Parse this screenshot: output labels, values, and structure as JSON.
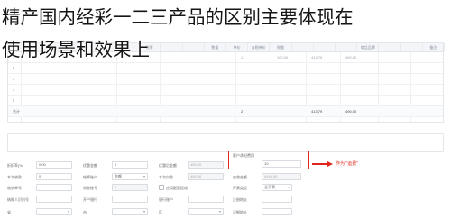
{
  "caption": {
    "line1": "精产国内经彩一二三产品的区别主要体现在",
    "line2": "使用场景和效果上"
  },
  "grid": {
    "columns": [
      "",
      "",
      "",
      "",
      "",
      "",
      "税率",
      "",
      "",
      "数量",
      "单价",
      "含税单价",
      "税额",
      "",
      "",
      "",
      "商品品牌",
      "",
      "",
      "备注"
    ],
    "row_numbers": [
      "1",
      "2",
      "3",
      "4",
      "5"
    ],
    "row_values": {
      "qty": "1",
      "price": "100.00",
      "amount": "413.75",
      "total": "490.00"
    },
    "total_row": {
      "label": "合计",
      "qty": "2",
      "amount": "413.79",
      "total": "490.00"
    }
  },
  "form": {
    "fields": [
      {
        "label": "折扣率(%)",
        "value": "0.00"
      },
      {
        "label": "优惠金额",
        "value": "0"
      },
      {
        "label": "优惠后金额",
        "value": "490.00"
      },
      {
        "label": "客户承担费用",
        "value": "10"
      },
      {
        "label": "本次收款",
        "value": "0"
      },
      {
        "label": "结算账户",
        "value": "金额"
      },
      {
        "label": "本次欠款",
        "value": "490.00"
      },
      {
        "label": "应收金额",
        "value": "4918.00"
      },
      {
        "label": "物流单号",
        "value": ""
      },
      {
        "label": "销售账号",
        "value": "0"
      },
      {
        "label": "应用配置提成",
        "value": ""
      },
      {
        "label": "开票类型",
        "value": "全开票"
      },
      {
        "label": "纳税人识别号",
        "value": ""
      },
      {
        "label": "开户银行",
        "value": ""
      },
      {
        "label": "银行账户",
        "value": ""
      },
      {
        "label": "注册地址",
        "value": ""
      },
      {
        "label": "省",
        "value": ""
      },
      {
        "label": "市",
        "value": ""
      },
      {
        "label": "区",
        "value": ""
      },
      {
        "label": "详细地址",
        "value": ""
      }
    ],
    "annotation": "作为 \"运费\""
  },
  "colors": {
    "highlight": "#e0261b",
    "border": "#d8dce1",
    "caption": "#151515"
  }
}
